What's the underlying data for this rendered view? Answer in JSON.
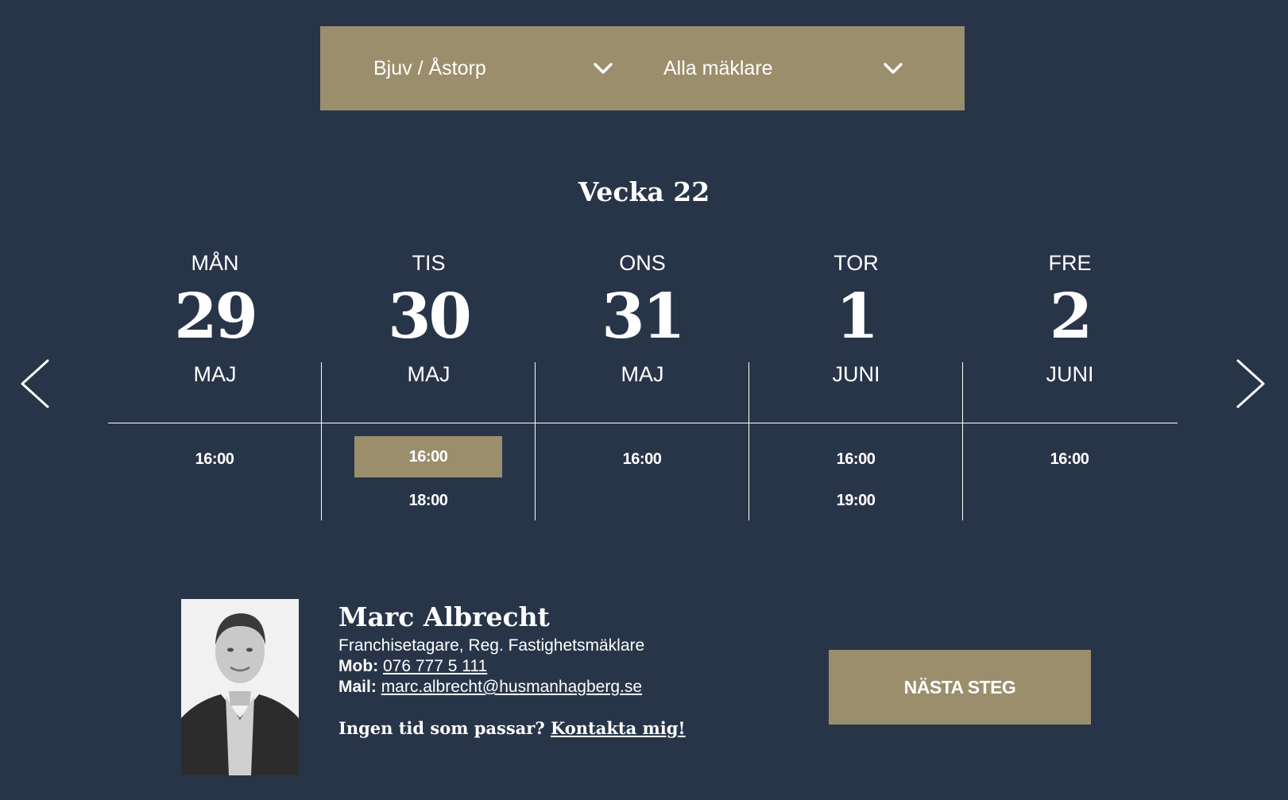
{
  "filters": {
    "office": {
      "value": "Bjuv / Åstorp",
      "icon": "chevron-down-icon"
    },
    "agent": {
      "value": "Alla mäklare",
      "icon": "chevron-down-icon"
    }
  },
  "calendar": {
    "week_label": "Vecka 22",
    "prev_icon": "chevron-left-icon",
    "next_icon": "chevron-right-icon",
    "days": [
      {
        "dow": "MÅN",
        "day": "29",
        "month": "MAJ",
        "slots": [
          "16:00"
        ]
      },
      {
        "dow": "TIS",
        "day": "30",
        "month": "MAJ",
        "slots": [
          "16:00",
          "18:00"
        ]
      },
      {
        "dow": "ONS",
        "day": "31",
        "month": "MAJ",
        "slots": [
          "16:00"
        ]
      },
      {
        "dow": "TOR",
        "day": "1",
        "month": "JUNI",
        "slots": [
          "16:00",
          "19:00"
        ]
      },
      {
        "dow": "FRE",
        "day": "2",
        "month": "JUNI",
        "slots": [
          "16:00"
        ]
      }
    ],
    "selected": {
      "day_index": 1,
      "slot_index": 0
    }
  },
  "agent": {
    "name": "Marc Albrecht",
    "title": "Franchisetagare, Reg. Fastighetsmäklare",
    "phone_label": "Mob:",
    "phone": "076 777 5 111",
    "email_label": "Mail:",
    "email": "marc.albrecht@husmanhagberg.se",
    "no_time_text": "Ingen tid som passar?",
    "contact_link": "Kontakta mig!"
  },
  "actions": {
    "next_label": "NÄSTA STEG"
  },
  "colors": {
    "background": "#283549",
    "accent": "#9b8e6d",
    "text": "#ffffff"
  }
}
